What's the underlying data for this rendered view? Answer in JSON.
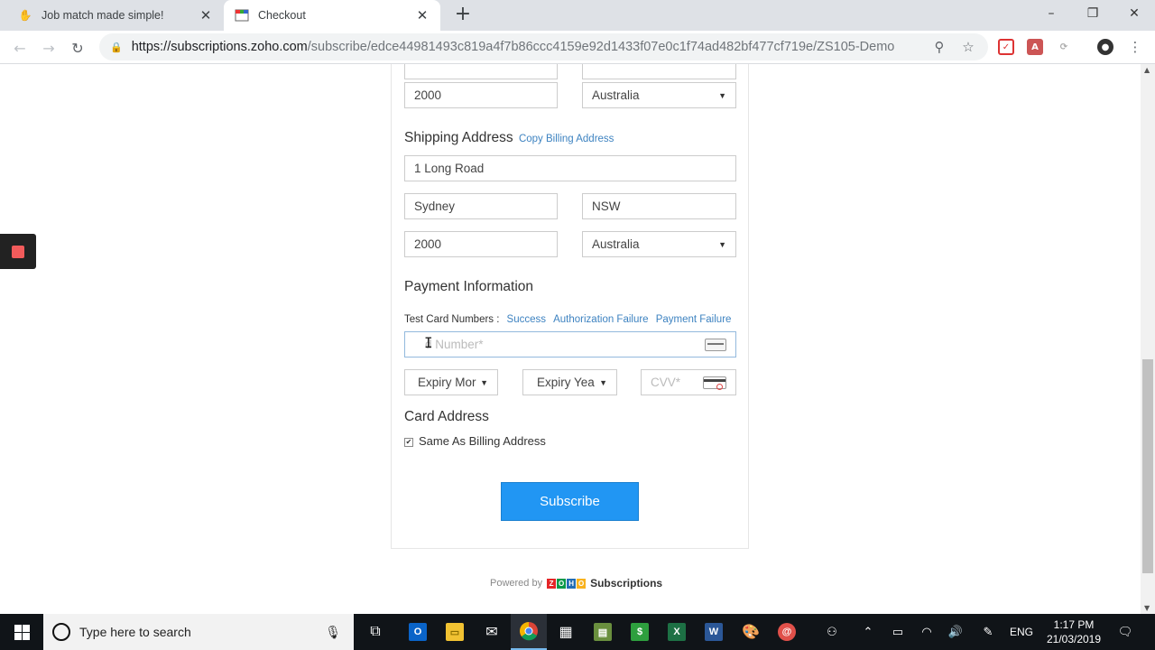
{
  "browser": {
    "tabs": [
      {
        "title": "Job match made simple!",
        "active": false,
        "favicon": "orange-hand-icon"
      },
      {
        "title": "Checkout",
        "active": true,
        "favicon": "checkout-calendar-icon"
      }
    ],
    "url_host": "https://subscriptions.zoho.com",
    "url_path": "/subscribe/edce44981493c819a4f7b86ccc4159e92d1433f07e0c1f74ad482bf477cf719e/ZS105-Demo"
  },
  "billing": {
    "postcode": "2000",
    "country": "Australia"
  },
  "shipping": {
    "title": "Shipping Address",
    "copy_link": "Copy Billing Address",
    "street": "1 Long Road",
    "city": "Sydney",
    "state": "NSW",
    "postcode": "2000",
    "country": "Australia"
  },
  "payment": {
    "title": "Payment Information",
    "test_label": "Test Card Numbers :",
    "test_links": [
      "Success",
      "Authorization Failure",
      "Payment Failure"
    ],
    "card_number_placeholder": "d Number*",
    "expiry_month": "Expiry Mor",
    "expiry_year": "Expiry Yea",
    "cvv_placeholder": "CVV*"
  },
  "card_address": {
    "title": "Card Address",
    "same_as_billing": "Same As Billing Address",
    "checked": true
  },
  "subscribe_label": "Subscribe",
  "footer": {
    "powered_by": "Powered by",
    "brand": "Subscriptions"
  },
  "taskbar": {
    "search_placeholder": "Type here to search",
    "language": "ENG",
    "time": "1:17 PM",
    "date": "21/03/2019"
  },
  "colors": {
    "accent": "#2196f3",
    "link": "#3e83c1",
    "taskbar": "#101418"
  }
}
